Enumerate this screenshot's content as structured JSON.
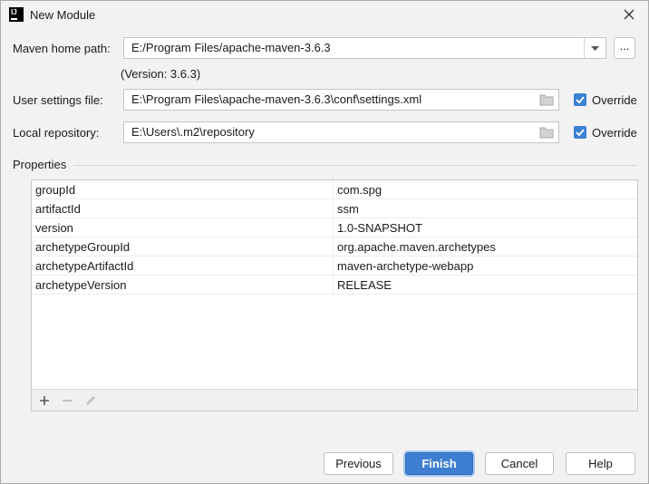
{
  "window": {
    "title": "New Module",
    "app_icon_text": "IJ"
  },
  "form": {
    "maven_home": {
      "label": "Maven home path:",
      "value": "E:/Program Files/apache-maven-3.6.3",
      "browse_label": "..."
    },
    "version_text": "(Version: 3.6.3)",
    "user_settings": {
      "label": "User settings file:",
      "value": "E:\\Program Files\\apache-maven-3.6.3\\conf\\settings.xml",
      "override_label": "Override",
      "override_checked": true
    },
    "local_repo": {
      "label": "Local repository:",
      "value": "E:\\Users\\.m2\\repository",
      "override_label": "Override",
      "override_checked": true
    }
  },
  "properties": {
    "title": "Properties",
    "rows": [
      {
        "key": "groupId",
        "value": "com.spg"
      },
      {
        "key": "artifactId",
        "value": "ssm"
      },
      {
        "key": "version",
        "value": "1.0-SNAPSHOT"
      },
      {
        "key": "archetypeGroupId",
        "value": "org.apache.maven.archetypes"
      },
      {
        "key": "archetypeArtifactId",
        "value": "maven-archetype-webapp"
      },
      {
        "key": "archetypeVersion",
        "value": "RELEASE"
      }
    ],
    "toolbar": [
      "add-icon",
      "remove-icon",
      "edit-icon"
    ]
  },
  "buttons": {
    "previous": "Previous",
    "finish": "Finish",
    "cancel": "Cancel",
    "help": "Help"
  },
  "colors": {
    "accent": "#3f7fd1",
    "checkbox": "#3c80d4"
  }
}
